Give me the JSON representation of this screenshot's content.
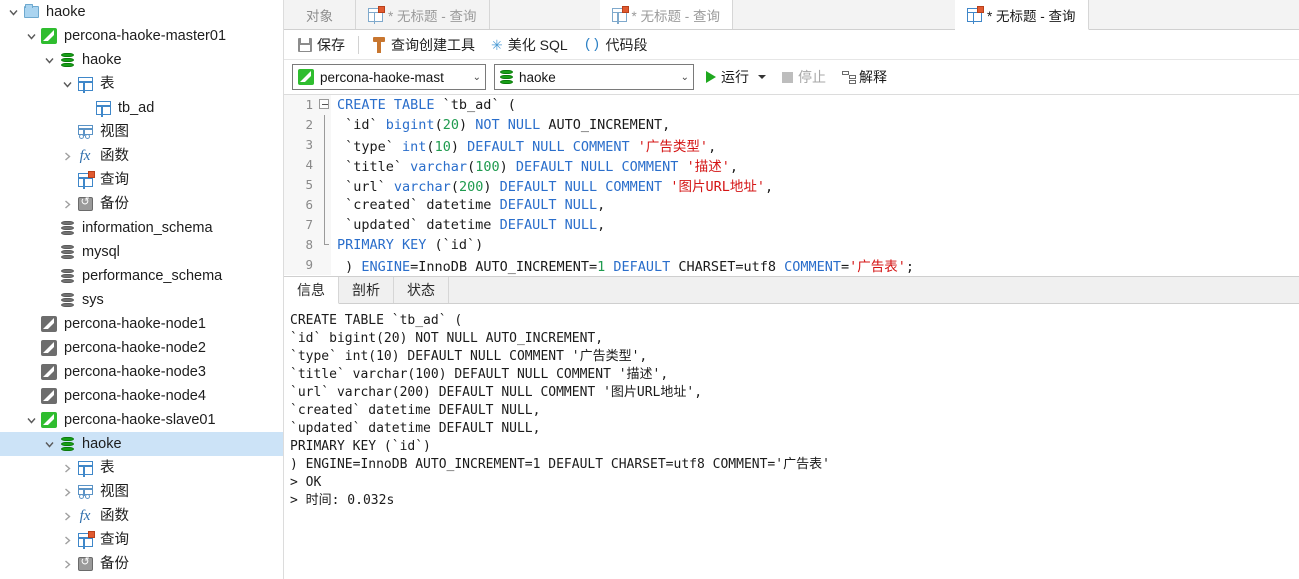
{
  "sidebar": {
    "items": [
      {
        "indent": 0,
        "twisty": "down",
        "icon": "folder-icon",
        "label": "haoke",
        "selected": false
      },
      {
        "indent": 1,
        "twisty": "down",
        "icon": "connection-icon",
        "label": "percona-haoke-master01",
        "selected": false
      },
      {
        "indent": 2,
        "twisty": "down",
        "icon": "database-icon",
        "label": "haoke",
        "selected": false
      },
      {
        "indent": 3,
        "twisty": "down",
        "icon": "table-folder-icon",
        "label": "表",
        "selected": false
      },
      {
        "indent": 4,
        "twisty": "none",
        "icon": "table-icon",
        "label": "tb_ad",
        "selected": false
      },
      {
        "indent": 3,
        "twisty": "none",
        "icon": "view-icon",
        "label": "视图",
        "selected": false
      },
      {
        "indent": 3,
        "twisty": "right",
        "icon": "function-icon",
        "label": "函数",
        "selected": false
      },
      {
        "indent": 3,
        "twisty": "none",
        "icon": "query-icon",
        "label": "查询",
        "selected": false
      },
      {
        "indent": 3,
        "twisty": "right",
        "icon": "backup-icon",
        "label": "备份",
        "selected": false
      },
      {
        "indent": 2,
        "twisty": "none",
        "icon": "database-gray-icon",
        "label": "information_schema",
        "selected": false
      },
      {
        "indent": 2,
        "twisty": "none",
        "icon": "database-gray-icon",
        "label": "mysql",
        "selected": false
      },
      {
        "indent": 2,
        "twisty": "none",
        "icon": "database-gray-icon",
        "label": "performance_schema",
        "selected": false
      },
      {
        "indent": 2,
        "twisty": "none",
        "icon": "database-gray-icon",
        "label": "sys",
        "selected": false
      },
      {
        "indent": 1,
        "twisty": "none",
        "icon": "connection-offline-icon",
        "label": "percona-haoke-node1",
        "selected": false
      },
      {
        "indent": 1,
        "twisty": "none",
        "icon": "connection-offline-icon",
        "label": "percona-haoke-node2",
        "selected": false
      },
      {
        "indent": 1,
        "twisty": "none",
        "icon": "connection-offline-icon",
        "label": "percona-haoke-node3",
        "selected": false
      },
      {
        "indent": 1,
        "twisty": "none",
        "icon": "connection-offline-icon",
        "label": "percona-haoke-node4",
        "selected": false
      },
      {
        "indent": 1,
        "twisty": "down",
        "icon": "connection-icon",
        "label": "percona-haoke-slave01",
        "selected": false
      },
      {
        "indent": 2,
        "twisty": "down",
        "icon": "database-icon",
        "label": "haoke",
        "selected": true
      },
      {
        "indent": 3,
        "twisty": "right",
        "icon": "table-folder-icon",
        "label": "表",
        "selected": false
      },
      {
        "indent": 3,
        "twisty": "right",
        "icon": "view-icon",
        "label": "视图",
        "selected": false
      },
      {
        "indent": 3,
        "twisty": "right",
        "icon": "function-icon",
        "label": "函数",
        "selected": false
      },
      {
        "indent": 3,
        "twisty": "right",
        "icon": "query-icon",
        "label": "查询",
        "selected": false
      },
      {
        "indent": 3,
        "twisty": "right",
        "icon": "backup-icon",
        "label": "备份",
        "selected": false
      }
    ]
  },
  "tabbar": {
    "object_tab": "对象",
    "tabs": [
      {
        "label": "* 无标题 - 查询",
        "active": false,
        "bg": "gray"
      },
      {
        "label": "* 无标题 - 查询",
        "active": false,
        "bg": "white"
      },
      {
        "label": "* 无标题 - 查询",
        "active": true,
        "bg": "white"
      }
    ]
  },
  "toolbar": {
    "save_label": "保存",
    "query_builder_label": "查询创建工具",
    "beautify_label": "美化 SQL",
    "snippet_label": "代码段",
    "snippet_icon": "()",
    "wand_icon": "✳"
  },
  "selector": {
    "connection_value": "percona-haoke-mast",
    "database_value": "haoke",
    "run_label": "运行",
    "stop_label": "停止",
    "explain_label": "解释"
  },
  "editor": {
    "lines": [
      {
        "n": "1",
        "fold": "start",
        "parts": [
          {
            "t": "CREATE TABLE ",
            "c": "k"
          },
          {
            "t": "`tb_ad` (",
            "c": "p"
          }
        ]
      },
      {
        "n": "2",
        "fold": "mid",
        "parts": [
          {
            "t": " `id` ",
            "c": "p"
          },
          {
            "t": "bigint",
            "c": "k"
          },
          {
            "t": "(",
            "c": "p"
          },
          {
            "t": "20",
            "c": "n"
          },
          {
            "t": ") ",
            "c": "p"
          },
          {
            "t": "NOT NULL",
            "c": "k"
          },
          {
            "t": " AUTO_INCREMENT,",
            "c": "p"
          }
        ]
      },
      {
        "n": "3",
        "fold": "mid",
        "parts": [
          {
            "t": " `type` ",
            "c": "p"
          },
          {
            "t": "int",
            "c": "k"
          },
          {
            "t": "(",
            "c": "p"
          },
          {
            "t": "10",
            "c": "n"
          },
          {
            "t": ") ",
            "c": "p"
          },
          {
            "t": "DEFAULT NULL COMMENT",
            "c": "k"
          },
          {
            "t": " ",
            "c": "p"
          },
          {
            "t": "'广告类型'",
            "c": "s"
          },
          {
            "t": ",",
            "c": "p"
          }
        ]
      },
      {
        "n": "4",
        "fold": "mid",
        "parts": [
          {
            "t": " `title` ",
            "c": "p"
          },
          {
            "t": "varchar",
            "c": "k"
          },
          {
            "t": "(",
            "c": "p"
          },
          {
            "t": "100",
            "c": "n"
          },
          {
            "t": ") ",
            "c": "p"
          },
          {
            "t": "DEFAULT NULL COMMENT",
            "c": "k"
          },
          {
            "t": " ",
            "c": "p"
          },
          {
            "t": "'描述'",
            "c": "s"
          },
          {
            "t": ",",
            "c": "p"
          }
        ]
      },
      {
        "n": "5",
        "fold": "mid",
        "parts": [
          {
            "t": " `url` ",
            "c": "p"
          },
          {
            "t": "varchar",
            "c": "k"
          },
          {
            "t": "(",
            "c": "p"
          },
          {
            "t": "200",
            "c": "n"
          },
          {
            "t": ") ",
            "c": "p"
          },
          {
            "t": "DEFAULT NULL COMMENT",
            "c": "k"
          },
          {
            "t": " ",
            "c": "p"
          },
          {
            "t": "'图片URL地址'",
            "c": "s"
          },
          {
            "t": ",",
            "c": "p"
          }
        ]
      },
      {
        "n": "6",
        "fold": "mid",
        "parts": [
          {
            "t": " `created` datetime ",
            "c": "p"
          },
          {
            "t": "DEFAULT NULL",
            "c": "k"
          },
          {
            "t": ",",
            "c": "p"
          }
        ]
      },
      {
        "n": "7",
        "fold": "mid",
        "parts": [
          {
            "t": " `updated` datetime ",
            "c": "p"
          },
          {
            "t": "DEFAULT NULL",
            "c": "k"
          },
          {
            "t": ",",
            "c": "p"
          }
        ]
      },
      {
        "n": "8",
        "fold": "end",
        "parts": [
          {
            "t": "PRIMARY KEY",
            "c": "k"
          },
          {
            "t": " (`id`)",
            "c": "p"
          }
        ]
      },
      {
        "n": "9",
        "fold": "none",
        "parts": [
          {
            "t": " ) ",
            "c": "p"
          },
          {
            "t": "ENGINE",
            "c": "k"
          },
          {
            "t": "=InnoDB AUTO_INCREMENT=",
            "c": "p"
          },
          {
            "t": "1",
            "c": "n"
          },
          {
            "t": " ",
            "c": "p"
          },
          {
            "t": "DEFAULT",
            "c": "k"
          },
          {
            "t": " CHARSET=utf8 ",
            "c": "p"
          },
          {
            "t": "COMMENT",
            "c": "k"
          },
          {
            "t": "=",
            "c": "p"
          },
          {
            "t": "'广告表'",
            "c": "s"
          },
          {
            "t": ";",
            "c": "p"
          }
        ]
      }
    ]
  },
  "results": {
    "tabs": [
      {
        "label": "信息",
        "active": true
      },
      {
        "label": "剖析",
        "active": false
      },
      {
        "label": "状态",
        "active": false
      }
    ],
    "output": [
      "CREATE TABLE `tb_ad` (",
      "`id` bigint(20) NOT NULL AUTO_INCREMENT,",
      "`type` int(10) DEFAULT NULL COMMENT '广告类型',",
      "`title` varchar(100) DEFAULT NULL COMMENT '描述',",
      "`url` varchar(200) DEFAULT NULL COMMENT '图片URL地址',",
      "`created` datetime DEFAULT NULL,",
      "`updated` datetime DEFAULT NULL,",
      "PRIMARY KEY (`id`)",
      ") ENGINE=InnoDB AUTO_INCREMENT=1 DEFAULT CHARSET=utf8 COMMENT='广告表'",
      "> OK",
      "> 时间: 0.032s"
    ]
  },
  "colors": {
    "selection": "#cce3f7",
    "keyword": "#2a6ecb",
    "string": "#d41414",
    "number": "#1f9b4f",
    "connected": "#2fbd2f",
    "offline": "#6d6d6d"
  }
}
